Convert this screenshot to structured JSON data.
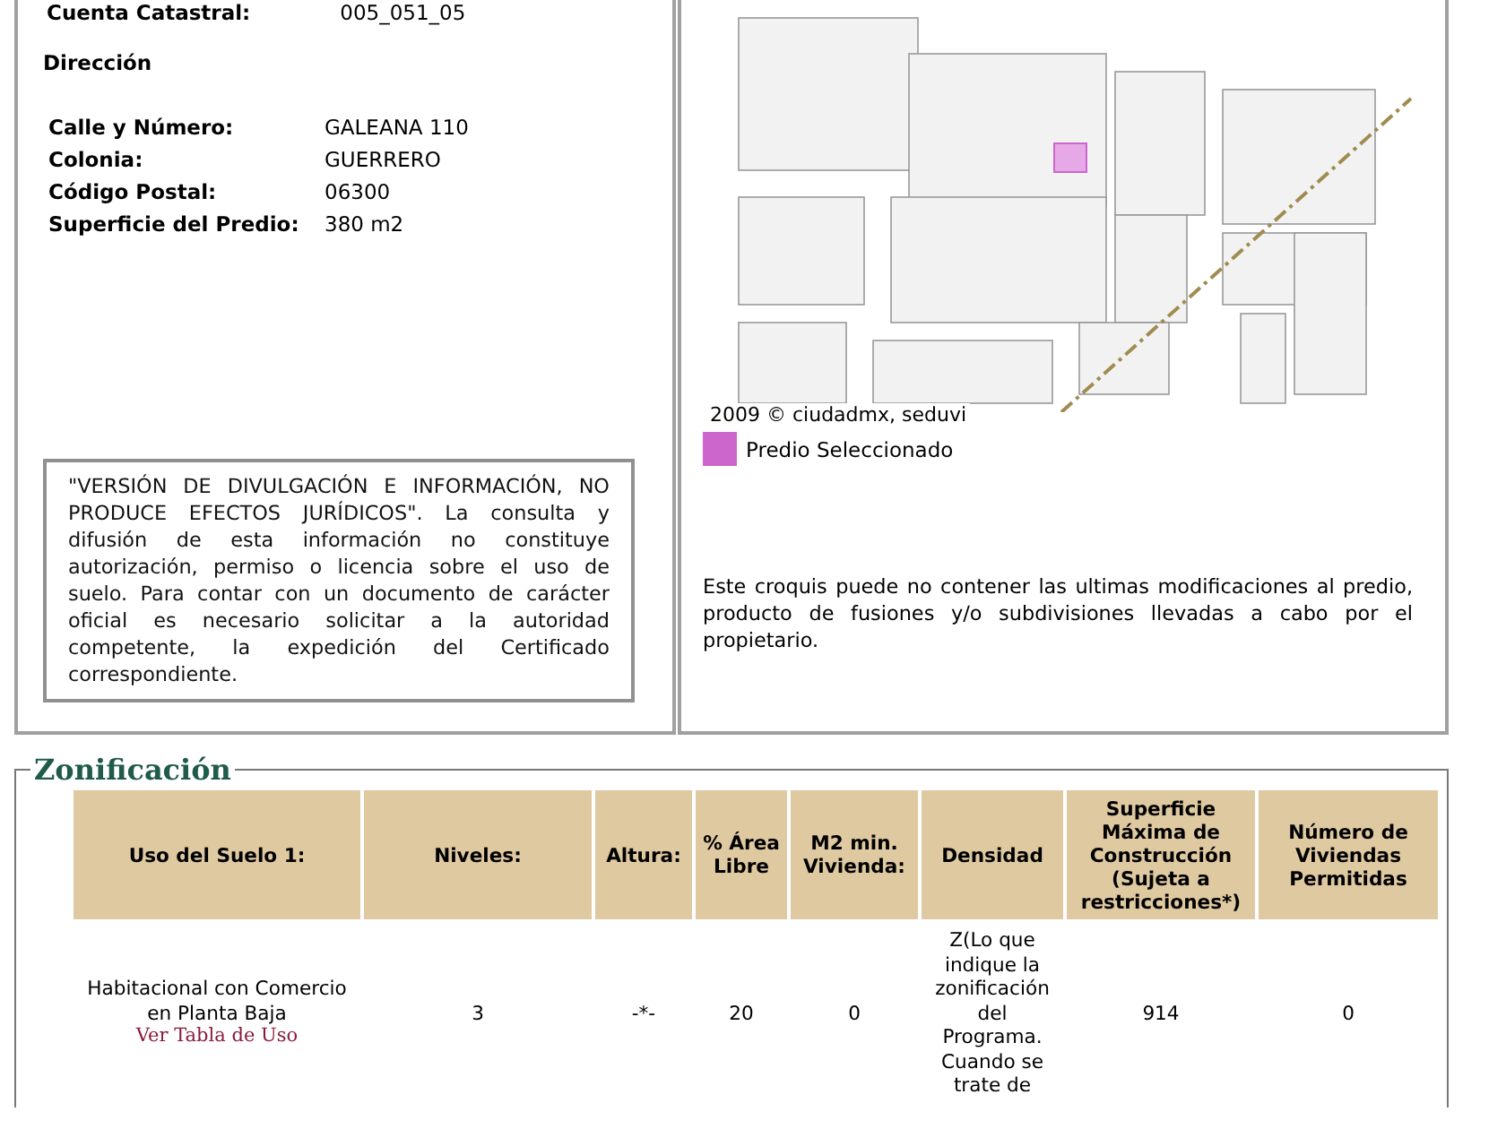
{
  "cuenta": {
    "label": "Cuenta Catastral:",
    "value": "005_051_05"
  },
  "direccion": {
    "title": "Dirección",
    "fields": [
      {
        "label": "Calle y Número:",
        "value": "GALEANA 110"
      },
      {
        "label": "Colonia:",
        "value": "GUERRERO"
      },
      {
        "label": "Código Postal:",
        "value": "06300"
      },
      {
        "label": "Superficie del Predio:",
        "value": "380 m2"
      }
    ]
  },
  "disclaimer": "\"VERSIÓN DE DIVULGACIÓN E INFORMACIÓN, NO PRODUCE EFECTOS JURÍDICOS\". La consulta y difusión de esta información no constituye autorización, permiso o licencia sobre el uso de suelo. Para contar con un documento de carácter oficial es necesario solicitar a la autoridad competente, la expedición del Certificado correspondiente.",
  "map": {
    "credit": "2009 © ciudadmx, seduvi",
    "legend": {
      "label": "Predio Seleccionado",
      "color": "#cc66cc"
    },
    "note": "Este croquis puede no contener las ultimas modificaciones al predio, producto de fusiones y/o subdivisiones llevadas a cabo por el propietario."
  },
  "zonificacion": {
    "title": "Zonificación",
    "columns": [
      "Uso del Suelo 1:",
      "Niveles:",
      "Altura:",
      "% Área Libre",
      "M2 min. Vivienda:",
      "Densidad",
      "Superficie Máxima de Construcción (Sujeta a restricciones*)",
      "Número de Viviendas Permitidas"
    ],
    "rows": [
      {
        "link": "Ver Tabla de Uso",
        "cells": [
          "Habitacional con Comercio en Planta Baja",
          "3",
          "-*-",
          "20",
          "0",
          "Z(Lo que indique la zonificación del Programa. Cuando se trate de",
          "914",
          "0"
        ]
      }
    ]
  }
}
